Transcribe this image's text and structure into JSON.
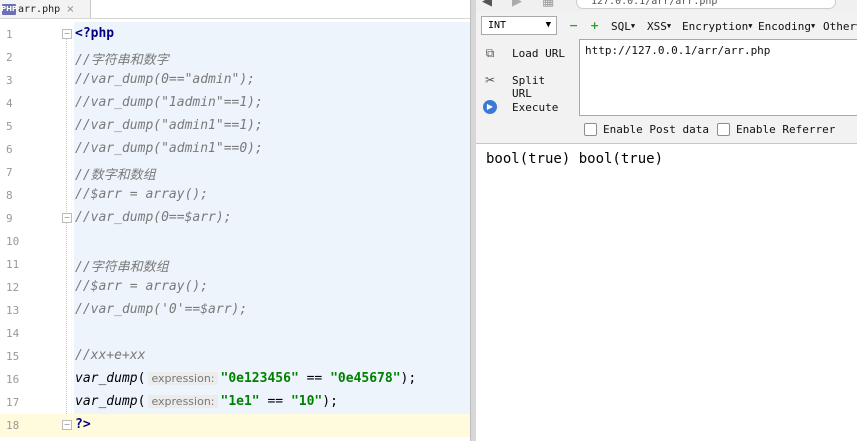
{
  "editor": {
    "tab_label": "arr.php",
    "tab_icon_text": "PHP",
    "tab_close": "×",
    "lines": [
      {
        "n": "1",
        "segments": [
          {
            "cls": "kw",
            "t": "<?php"
          }
        ]
      },
      {
        "n": "2",
        "segments": [
          {
            "cls": "cmt",
            "t": "//字符串和数字"
          }
        ]
      },
      {
        "n": "3",
        "segments": [
          {
            "cls": "cmt",
            "t": "//var_dump(0==\"admin\");"
          }
        ]
      },
      {
        "n": "4",
        "segments": [
          {
            "cls": "cmt",
            "t": "//var_dump(\"1admin\"==1);"
          }
        ]
      },
      {
        "n": "5",
        "segments": [
          {
            "cls": "cmt",
            "t": "//var_dump(\"admin1\"==1);"
          }
        ]
      },
      {
        "n": "6",
        "segments": [
          {
            "cls": "cmt",
            "t": "//var_dump(\"admin1\"==0);"
          }
        ]
      },
      {
        "n": "7",
        "segments": [
          {
            "cls": "cmt",
            "t": "//数字和数组"
          }
        ]
      },
      {
        "n": "8",
        "segments": [
          {
            "cls": "cmt",
            "t": "//$arr = array();"
          }
        ]
      },
      {
        "n": "9",
        "segments": [
          {
            "cls": "cmt",
            "t": "//var_dump(0==$arr);"
          }
        ]
      },
      {
        "n": "10",
        "segments": []
      },
      {
        "n": "11",
        "segments": [
          {
            "cls": "cmt",
            "t": "//字符串和数组"
          }
        ]
      },
      {
        "n": "12",
        "segments": [
          {
            "cls": "cmt",
            "t": "//$arr = array();"
          }
        ]
      },
      {
        "n": "13",
        "segments": [
          {
            "cls": "cmt",
            "t": "//var_dump('0'==$arr);"
          }
        ]
      },
      {
        "n": "14",
        "segments": []
      },
      {
        "n": "15",
        "segments": [
          {
            "cls": "cmt",
            "t": "//xx+e+xx"
          }
        ]
      },
      {
        "n": "16",
        "segments": [
          {
            "cls": "fn",
            "t": "var_dump"
          },
          {
            "cls": "plain",
            "t": "("
          },
          {
            "cls": "hint",
            "t": "expression:"
          },
          {
            "cls": "str",
            "t": "\"0e123456\""
          },
          {
            "cls": "plain",
            "t": " == "
          },
          {
            "cls": "str",
            "t": "\"0e45678\""
          },
          {
            "cls": "plain",
            "t": ");"
          }
        ]
      },
      {
        "n": "17",
        "segments": [
          {
            "cls": "fn",
            "t": "var_dump"
          },
          {
            "cls": "plain",
            "t": "("
          },
          {
            "cls": "hint",
            "t": "expression:"
          },
          {
            "cls": "str",
            "t": "\"1e1\""
          },
          {
            "cls": "plain",
            "t": " == "
          },
          {
            "cls": "str",
            "t": "\"10\""
          },
          {
            "cls": "plain",
            "t": ");"
          }
        ]
      },
      {
        "n": "18",
        "segments": [
          {
            "cls": "kw",
            "t": "?>"
          }
        ]
      }
    ],
    "current_line": "18"
  },
  "browser": {
    "address_partial": "127.0.0.1/arr/arr.php",
    "hackbar": {
      "select_value": "INT",
      "menus": [
        "SQL",
        "XSS",
        "Encryption",
        "Encoding",
        "Other"
      ],
      "load_url": "Load URL",
      "split_url": "Split URL",
      "execute": "Execute",
      "url_value": "http://127.0.0.1/arr/arr.php",
      "enable_post": "Enable Post data",
      "enable_referrer": "Enable Referrer"
    },
    "output": "bool(true) bool(true)"
  }
}
